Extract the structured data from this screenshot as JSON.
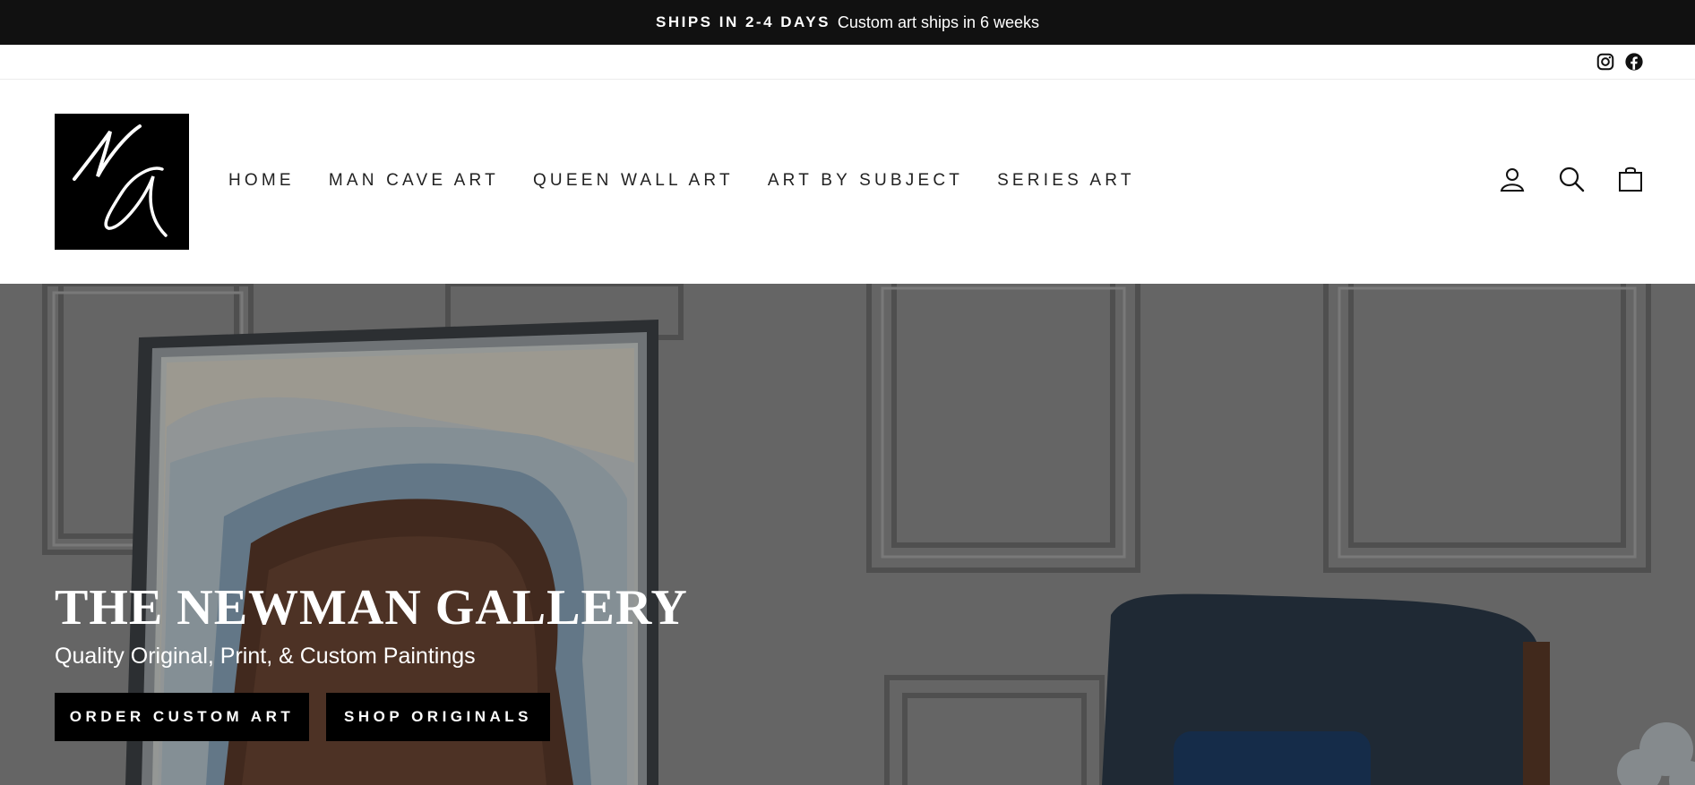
{
  "announcement": {
    "strong": "SHIPS IN 2-4 DAYS",
    "text": "Custom art ships in 6 weeks"
  },
  "social": [
    {
      "icon": "instagram-icon"
    },
    {
      "icon": "facebook-icon"
    }
  ],
  "logo": {
    "alt": "NG"
  },
  "nav": {
    "items": [
      {
        "label": "HOME"
      },
      {
        "label": "MAN CAVE ART"
      },
      {
        "label": "QUEEN WALL ART"
      },
      {
        "label": "ART BY SUBJECT"
      },
      {
        "label": "SERIES ART"
      }
    ]
  },
  "header_icons": [
    "account-icon",
    "search-icon",
    "cart-icon"
  ],
  "hero": {
    "title": "THE NEWMAN GALLERY",
    "subtitle": "Quality Original, Print, & Custom Paintings",
    "buttons": [
      {
        "label": "ORDER CUSTOM ART"
      },
      {
        "label": "SHOP ORIGINALS"
      }
    ]
  },
  "colors": {
    "announcement_bg": "#111111",
    "button_bg": "#000000",
    "text": "#222222"
  }
}
